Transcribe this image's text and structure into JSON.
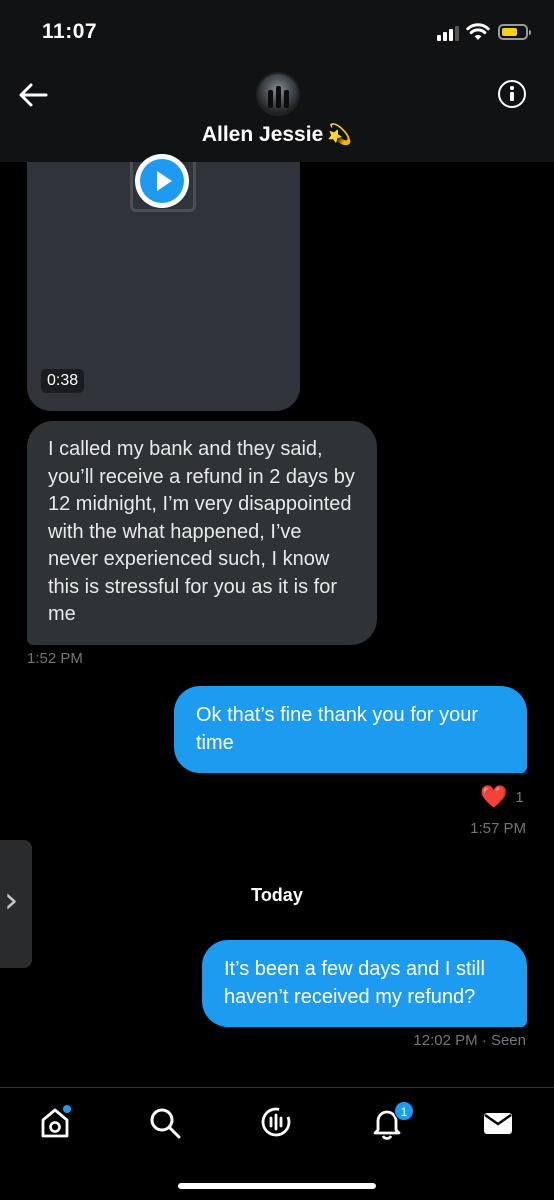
{
  "status_bar": {
    "time": "11:07",
    "icons": [
      "signal-icon",
      "wifi-icon",
      "battery-icon"
    ],
    "battery_color": "#f5d013"
  },
  "header": {
    "contact_name": "Allen Jessie",
    "name_emoji": "💫",
    "icons": [
      "back-arrow-icon",
      "info-icon"
    ]
  },
  "colors": {
    "accent": "#1d9bf0",
    "incoming_bubble": "#2f3336",
    "background": "#000000",
    "heart": "#e0245e"
  },
  "messages": [
    {
      "type": "video",
      "direction": "in",
      "duration": "0:38"
    },
    {
      "type": "text",
      "direction": "in",
      "text": "I called my bank and they said, you’ll receive a refund in 2 days by 12 midnight, I’m very disappointed with the what happened, I’ve never experienced such, I know this is stressful for you as it is for me",
      "time": "1:52 PM"
    },
    {
      "type": "text",
      "direction": "out",
      "text": "Ok that’s fine thank you for your time",
      "reaction": "❤️",
      "reaction_count": "1",
      "time": "1:57 PM"
    },
    {
      "type": "divider",
      "label": "Today"
    },
    {
      "type": "text",
      "direction": "out",
      "text": "It’s been a few days and I still haven’t received my refund?",
      "time": "12:02 PM",
      "status": "· Seen"
    }
  ],
  "side_panel": {
    "icon": "chevron-right-icon"
  },
  "tabbar": {
    "tabs": [
      {
        "name": "home",
        "icon": "home-icon",
        "has_dot": true
      },
      {
        "name": "search",
        "icon": "search-icon"
      },
      {
        "name": "spaces",
        "icon": "spaces-icon"
      },
      {
        "name": "notifications",
        "icon": "bell-icon",
        "badge": "1"
      },
      {
        "name": "messages",
        "icon": "mail-icon"
      }
    ]
  }
}
